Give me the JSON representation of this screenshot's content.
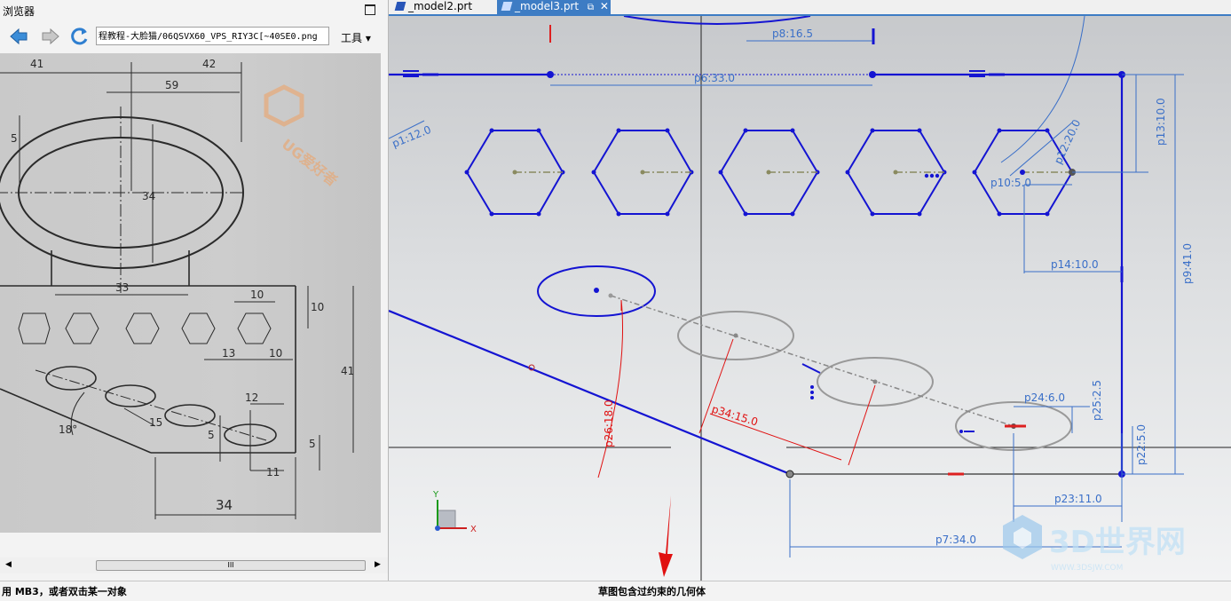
{
  "browser": {
    "title": "浏览器",
    "address": "程教程-大脸猫/06QSVX60_VPS_RIY3C[~40SE0.png",
    "tools_label": "工具",
    "scroll_thumb_mark": "III"
  },
  "drawing": {
    "dims": [
      "41",
      "42",
      "59",
      "5",
      "34",
      "33",
      "10",
      "10",
      "13",
      "10",
      "12",
      "15",
      "18°",
      "5",
      "11",
      "34",
      "5",
      "41",
      "10"
    ],
    "watermark": "UG爱好者"
  },
  "tabs": [
    {
      "label": "_model2.prt"
    },
    {
      "label": "_model3.prt"
    }
  ],
  "sketch": {
    "dims": [
      "p8:16.5",
      "p6:33.0",
      "p1:12.0",
      "p12:20.0",
      "p13:10.0",
      "p10:5.0",
      "p14:10.0",
      "p9:41.0",
      "p26:18.0",
      "p34:15.0",
      "p24:6.0",
      "p25:2.5",
      "p22:5.0",
      "p23:11.0",
      "p7:34.0"
    ],
    "axis_y": "Y",
    "axis_x": "X",
    "watermark_title": "3D世界网",
    "watermark_url": "WWW.3DSJW.COM"
  },
  "status": {
    "left": "用 MB3，或者双击某一对象",
    "center": "草图包含过约束的几何体"
  },
  "colors": {
    "sketch_blue": "#1414d2",
    "dim_blue": "#3a6fc8",
    "dim_red": "#e01010",
    "tab_active": "#3d7cc4"
  }
}
